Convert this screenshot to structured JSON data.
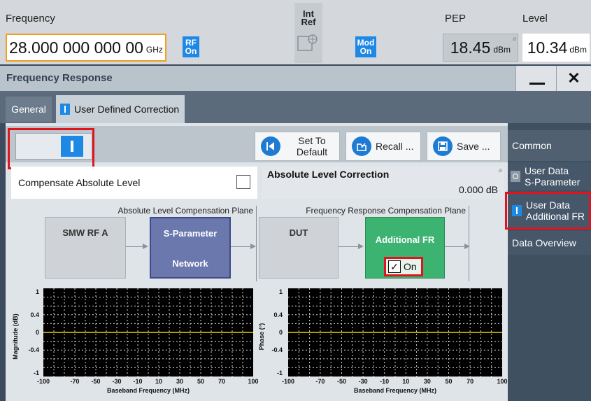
{
  "header": {
    "frequency_label": "Frequency",
    "frequency_value": "28.000 000 000 00",
    "frequency_unit": "GHz",
    "rf_line1": "RF",
    "rf_line2": "On",
    "int_ref_line1": "Int",
    "int_ref_line2": "Ref",
    "mod_line1": "Mod",
    "mod_line2": "On",
    "pep_label": "PEP",
    "pep_value": "18.45",
    "pep_unit": "dBm",
    "level_label": "Level",
    "level_value": "10.34",
    "level_unit": "dBm"
  },
  "dialog": {
    "title": "Frequency Response",
    "minimize_symbol": "—",
    "close_symbol": "✕"
  },
  "tabs": [
    {
      "label": "General"
    },
    {
      "label": "User Defined Correction"
    }
  ],
  "toolbar": {
    "set_default_line1": "Set To",
    "set_default_line2": "Default",
    "recall_label": "Recall ...",
    "save_label": "Save ..."
  },
  "settings": {
    "compensate_label": "Compensate Absolute Level",
    "abs_level_label": "Absolute Level Correction",
    "abs_level_value": "0.000 dB"
  },
  "diagram": {
    "plane1_label": "Absolute Level Compensation Plane",
    "plane2_label": "Frequency Response Compensation Plane",
    "block1": "SMW RF  A",
    "block2_line1": "S-Parameter",
    "block2_line2": "Network",
    "block3": "DUT",
    "block4": "Additional FR",
    "block4_checkbox": "On"
  },
  "side_panel": {
    "common": "Common",
    "item1_line1": "User Data",
    "item1_line2": "S-Parameter",
    "item2_line1": "User Data",
    "item2_line2": "Additional FR",
    "item3": "Data Overview"
  },
  "chart_data": [
    {
      "type": "line",
      "ylabel": "Magnitude (dB)",
      "xlabel": "Baseband Frequency (MHz)",
      "xlim": [
        -100,
        100
      ],
      "ylim": [
        -1,
        1
      ],
      "x_ticks": [
        "-100",
        "-70",
        "-50",
        "-30",
        "-10",
        "10",
        "30",
        "50",
        "70",
        "100"
      ],
      "y_ticks": [
        "1",
        "0.4",
        "0",
        "-0.4",
        "-1"
      ],
      "grid": true,
      "series": [
        {
          "x": [
            -100,
            100
          ],
          "values": [
            0,
            0
          ],
          "color": "#e8d400"
        }
      ]
    },
    {
      "type": "line",
      "ylabel": "Phase (°)",
      "xlabel": "Baseband Frequency (MHz)",
      "xlim": [
        -100,
        100
      ],
      "ylim": [
        -1,
        1
      ],
      "x_ticks": [
        "-100",
        "-70",
        "-50",
        "-30",
        "-10",
        "10",
        "30",
        "50",
        "70",
        "100"
      ],
      "y_ticks": [
        "1",
        "0.4",
        "0",
        "-0.4",
        "-1"
      ],
      "grid": true,
      "series": [
        {
          "x": [
            -100,
            100
          ],
          "values": [
            0,
            0
          ],
          "color": "#e8d400"
        }
      ]
    }
  ],
  "colors": {
    "accent_blue": "#1e88e5",
    "highlight_red": "#e0141e",
    "trace_yellow": "#e8d400",
    "additional_fr_green": "#3cb371",
    "sparam_blue": "#6a78ad"
  }
}
